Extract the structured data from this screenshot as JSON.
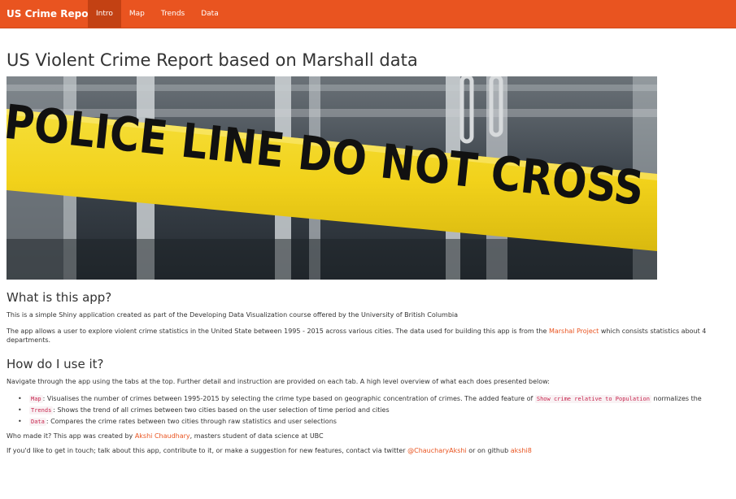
{
  "navbar": {
    "brand": "US Crime Report",
    "tabs": [
      {
        "label": "Intro",
        "active": true
      },
      {
        "label": "Map",
        "active": false
      },
      {
        "label": "Trends",
        "active": false
      },
      {
        "label": "Data",
        "active": false
      }
    ],
    "color": "#e95420",
    "active_color": "#c34113"
  },
  "page_title": "US Violent Crime Report based on Marshall data",
  "hero_image": {
    "text": "POLICE LINE DO NOT CROSS",
    "tape_color": "#f2d21b"
  },
  "what": {
    "heading": "What is this app?",
    "p1": "This is a simple Shiny application created as part of the Developing Data Visualization course offered by the University of British Columbia",
    "p2_before": "The app allows a user to explore violent crime statistics in the United State between 1995 - 2015 across various cities. The data used for building this app is from the ",
    "p2_link": "Marshal Project",
    "p2_after": " which consists statistics about 4",
    "p2_line2": "departments."
  },
  "how": {
    "heading": "How do I use it?",
    "intro": "Navigate through the app using the tabs at the top. Further detail and instruction are provided on each tab. A high level overview of what each does presented below:",
    "items": [
      {
        "code": "Map",
        "text": ": Visualises the number of crimes between 1995-2015 by selecting the crime type based on geographic concentration of crimes. The added feature of ",
        "code2": "Show crime relative to Population",
        "text2": " normalizes the"
      },
      {
        "code": "Trends",
        "text": ": Shows the trend of all crimes between two cities based on the user selection of time period and cities"
      },
      {
        "code": "Data",
        "text": ": Compares the crime rates between two cities through raw statistics and user selections"
      }
    ]
  },
  "who": {
    "before": "Who made it? This app was created by ",
    "link": "Akshi Chaudhary",
    "after": ", masters student of data science at UBC"
  },
  "contact": {
    "before": "If you'd like to get in touch; talk about this app, contribute to it, or make a suggestion for new features, contact via twitter ",
    "twitter": "@ChaucharyAkshi",
    "middle": " or on github ",
    "github": "akshi8"
  }
}
